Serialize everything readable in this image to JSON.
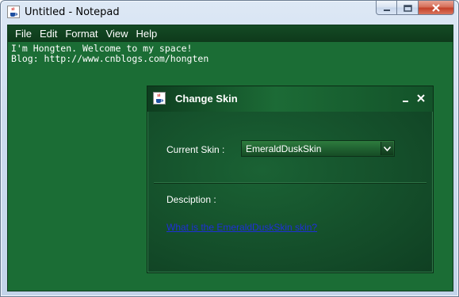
{
  "window": {
    "title": "Untitled - Notepad"
  },
  "menu": {
    "items": [
      "File",
      "Edit",
      "Format",
      "View",
      "Help"
    ]
  },
  "editor": {
    "lines": [
      "I'm Hongten. Welcome to my space!",
      "Blog: http://www.cnblogs.com/hongten"
    ]
  },
  "dialog": {
    "title": "Change Skin",
    "current_skin_label": "Current Skin :",
    "current_skin_value": "EmeraldDuskSkin",
    "description_label": "Desciption :",
    "description_link": "What is the EmeraldDuskSkin skin?"
  },
  "icons": {
    "app": "java-cup-icon",
    "minimize": "minimize-icon",
    "maximize": "maximize-icon",
    "close": "close-icon",
    "dropdown": "chevron-down-icon"
  },
  "colors": {
    "client_bg": "#1b6d35",
    "menubar_bg": "#0e3a1b",
    "dialog_bg": "#12502a",
    "link": "#1f2fd8",
    "close_button": "#c4422a"
  }
}
